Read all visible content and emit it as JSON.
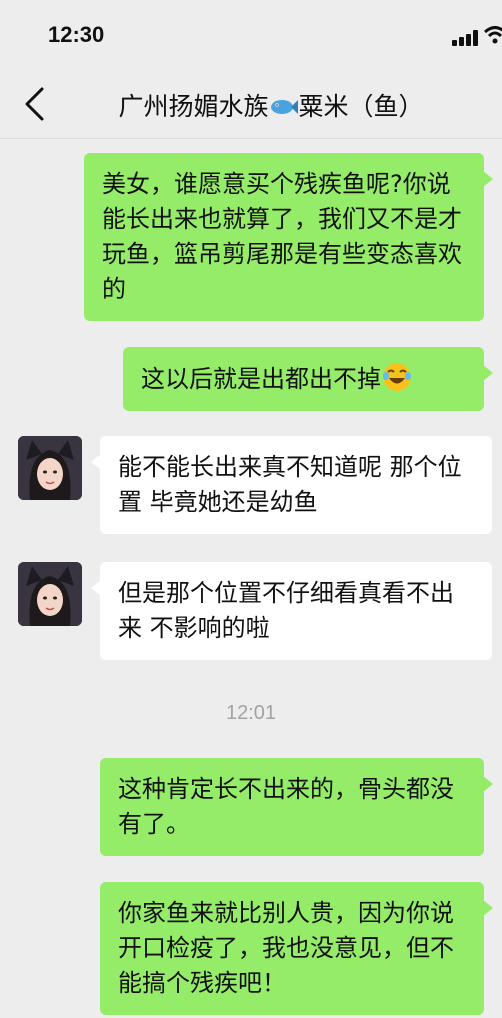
{
  "status_bar": {
    "time": "12:30"
  },
  "nav": {
    "title": "广州扬媚水族",
    "title_suffix": "粟米（鱼）"
  },
  "messages": [
    {
      "from": "me",
      "text": "美女，谁愿意买个残疾鱼呢?你说能长出来也就算了，我们又不是才玩鱼，篮吊剪尾那是有些变态喜欢的"
    },
    {
      "from": "me",
      "text": "这以后就是出都出不掉",
      "emoji": "rofl-emoji"
    },
    {
      "from": "them",
      "text": "能不能长出来真不知道呢 那个位置 毕竟她还是幼鱼"
    },
    {
      "from": "them",
      "text": "但是那个位置不仔细看真看不出来 不影响的啦"
    },
    {
      "from": "me",
      "text": "这种肯定长不出来的，骨头都没有了。"
    },
    {
      "from": "me",
      "text": "你家鱼来就比别人贵，因为你说开口检疫了，我也没意见，但不能搞个残疾吧！"
    }
  ],
  "timestamp": "12:01",
  "colors": {
    "sent_bubble": "#95ec69",
    "received_bubble": "#ffffff",
    "background": "#ededed"
  }
}
